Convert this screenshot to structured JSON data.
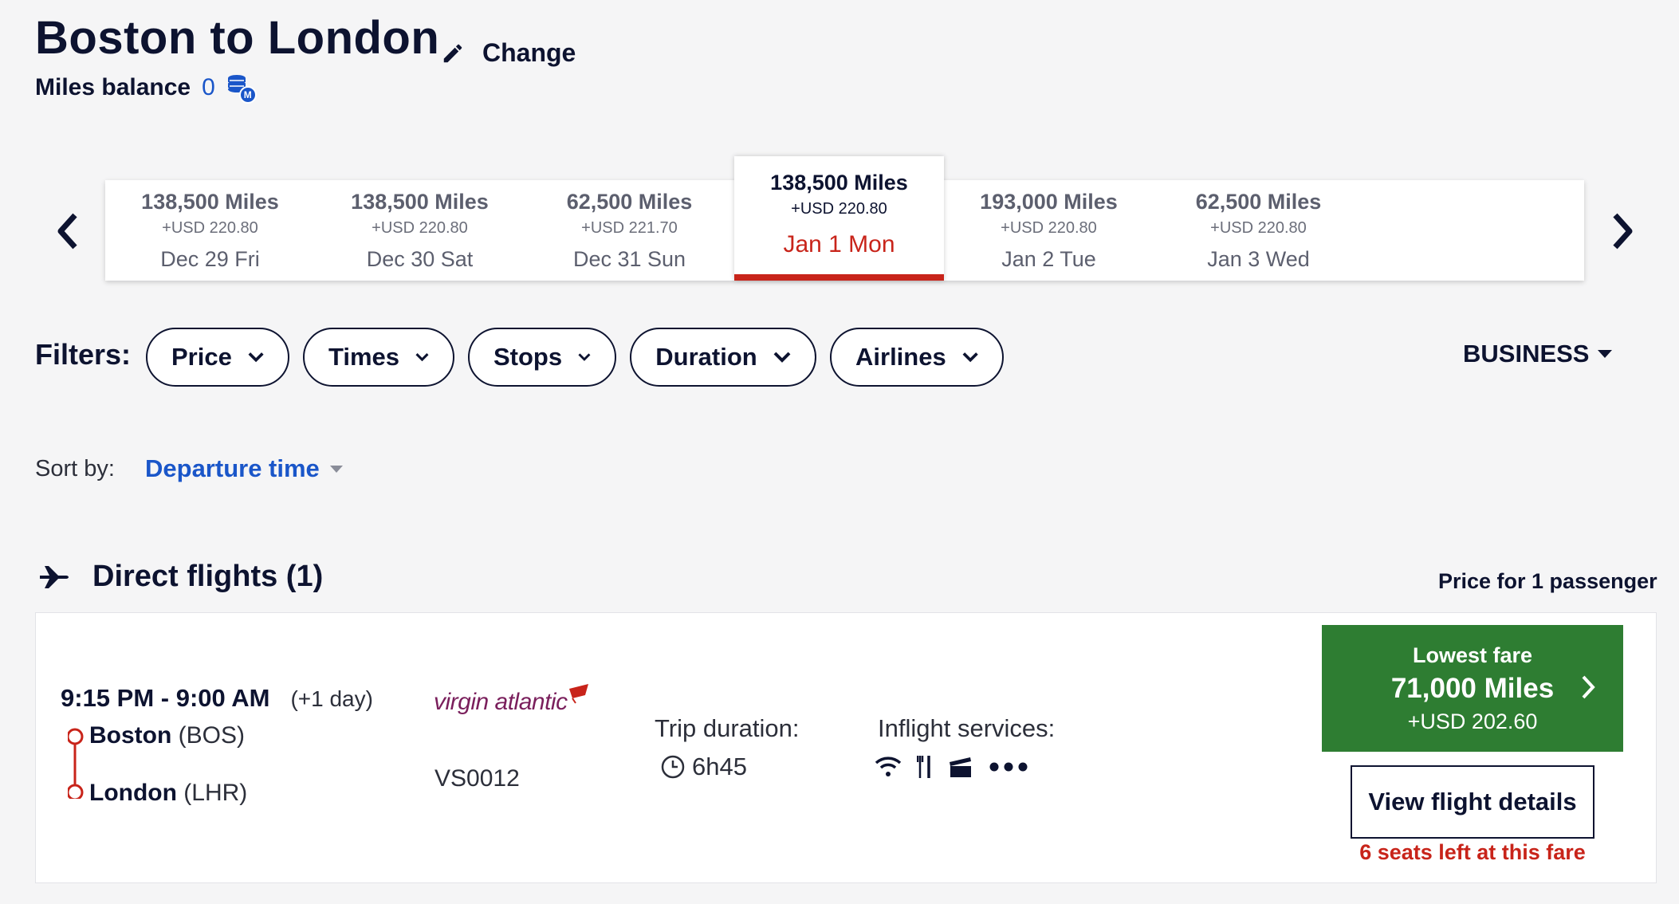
{
  "header": {
    "title": "Boston to London",
    "change_label": "Change",
    "miles_balance_label": "Miles balance",
    "miles_balance_value": "0",
    "miles_icon_letter": "M"
  },
  "dates": [
    {
      "miles": "138,500 Miles",
      "usd": "+USD 220.80",
      "day": "Dec 29 Fri",
      "selected": false
    },
    {
      "miles": "138,500 Miles",
      "usd": "+USD 220.80",
      "day": "Dec 30 Sat",
      "selected": false
    },
    {
      "miles": "62,500 Miles",
      "usd": "+USD 221.70",
      "day": "Dec 31 Sun",
      "selected": false
    },
    {
      "miles": "138,500 Miles",
      "usd": "+USD 220.80",
      "day": "Jan 1 Mon",
      "selected": true
    },
    {
      "miles": "193,000 Miles",
      "usd": "+USD 220.80",
      "day": "Jan 2 Tue",
      "selected": false
    },
    {
      "miles": "62,500 Miles",
      "usd": "+USD 220.80",
      "day": "Jan 3 Wed",
      "selected": false
    }
  ],
  "filters": {
    "label": "Filters:",
    "items": [
      "Price",
      "Times",
      "Stops",
      "Duration",
      "Airlines"
    ],
    "cabin": "BUSINESS"
  },
  "sort": {
    "label": "Sort by:",
    "value": "Departure time"
  },
  "section": {
    "title": "Direct flights (1)",
    "price_note": "Price for 1 passenger"
  },
  "flight": {
    "times": "9:15 PM - 9:00 AM",
    "day_offset": "(+1 day)",
    "origin_city": "Boston",
    "origin_code": "(BOS)",
    "dest_city": "London",
    "dest_code": "(LHR)",
    "airline": "virgin atlantic",
    "flight_number": "VS0012",
    "duration_label": "Trip duration:",
    "duration": "6h45",
    "services_label": "Inflight services:",
    "services": [
      "wifi-icon",
      "meal-icon",
      "entertainment-icon",
      "more-icon"
    ],
    "fare_label": "Lowest fare",
    "fare_miles": "71,000 Miles",
    "fare_usd": "+USD 202.60",
    "details_label": "View flight details",
    "seats_left": "6 seats left at this fare"
  },
  "colors": {
    "navy": "#0d1330",
    "accent_blue": "#1a56c9",
    "selected_red": "#c8241a",
    "fare_green": "#2e7d32"
  }
}
